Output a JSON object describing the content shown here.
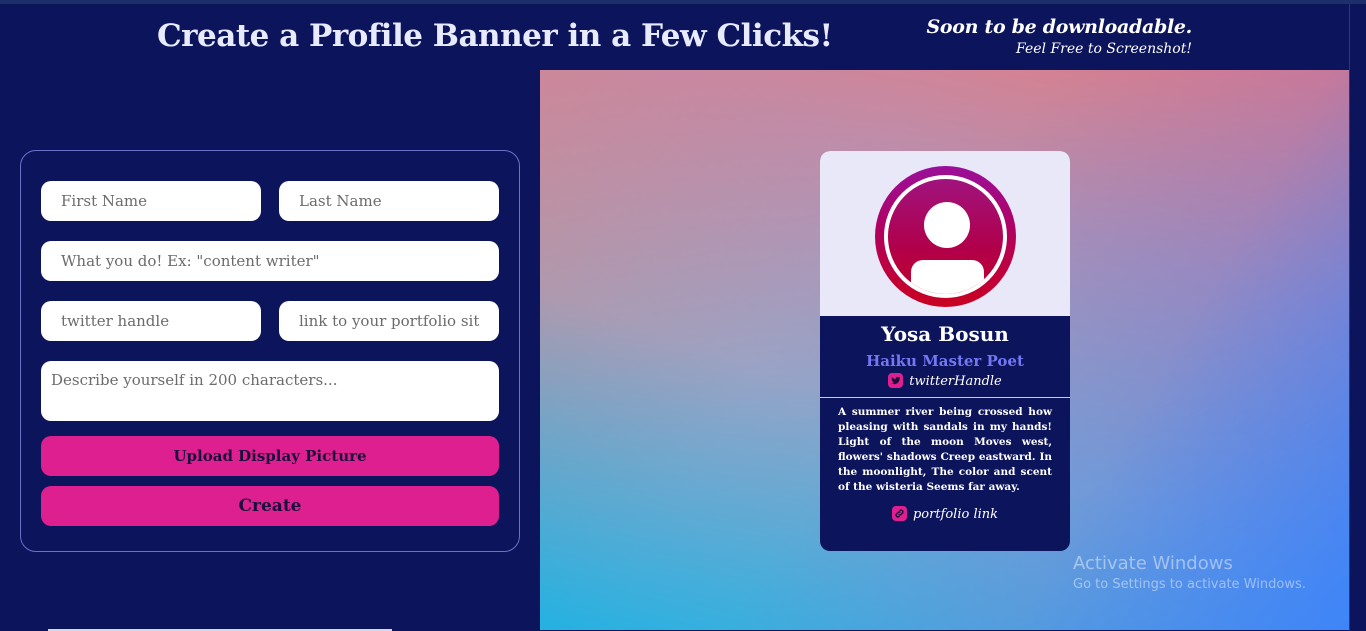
{
  "header": {
    "title": "Create a Profile Banner in a Few Clicks!",
    "soon_line1": "Soon to be downloadable.",
    "soon_line2": "Feel Free to Screenshot!"
  },
  "form": {
    "first_name_placeholder": "First Name",
    "last_name_placeholder": "Last Name",
    "role_placeholder": "What you do! Ex: \"content writer\"",
    "twitter_placeholder": "twitter handle",
    "portfolio_placeholder": "link to your portfolio site",
    "bio_placeholder": "Describe yourself in 200 characters...",
    "upload_label": "Upload Display Picture",
    "create_label": "Create"
  },
  "card": {
    "name": "Yosa Bosun",
    "role": "Haiku Master Poet",
    "twitter": "twitterHandle",
    "bio": "A summer river being crossed how pleasing with sandals in my hands! Light of the moon Moves west, flowers' shadows Creep eastward. In the moonlight, The color and scent of the wisteria Seems far away.",
    "link": "portfolio link"
  },
  "watermark": {
    "line1": "Activate Windows",
    "line2": "Go to Settings to activate Windows."
  },
  "colors": {
    "background": "#0c145c",
    "accent": "#de1f8f",
    "role_text": "#7477f4"
  },
  "icons": {
    "twitter": "twitter-icon",
    "link": "link-icon",
    "avatar": "user-avatar-icon"
  }
}
